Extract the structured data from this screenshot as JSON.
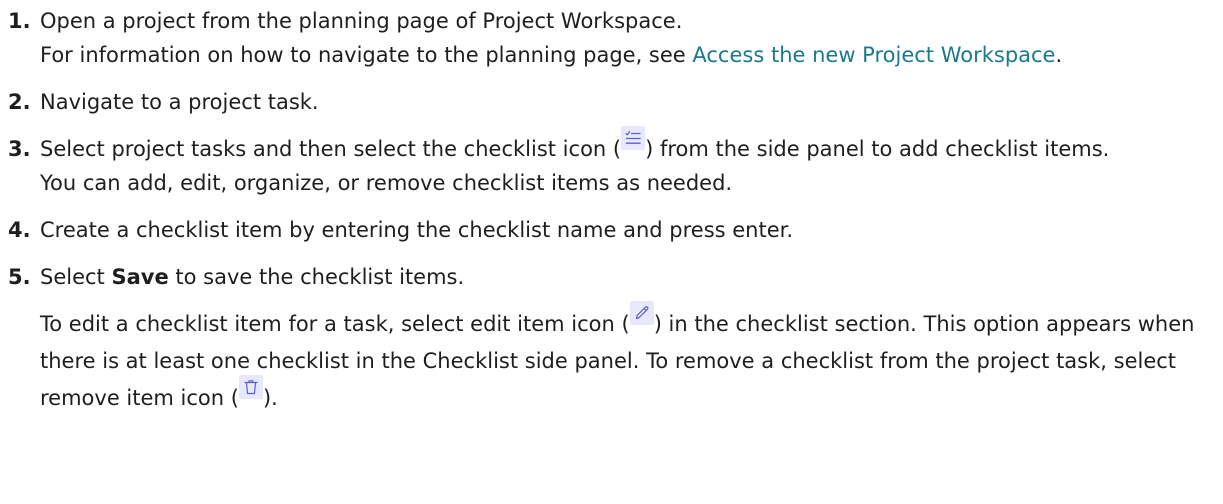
{
  "steps": [
    {
      "number": "1.",
      "line1": "Open a project from the planning page of Project Workspace.",
      "line2_prefix": "For information on how to navigate to the planning page, see ",
      "line2_link": "Access the new Project Workspace",
      "line2_suffix": "."
    },
    {
      "number": "2.",
      "text": "Navigate to a project task."
    },
    {
      "number": "3.",
      "text_before_icon": "Select project tasks and then select the checklist icon (",
      "icon": "checklist-icon",
      "text_after_icon": ") from the side panel to add checklist items.",
      "line2": "You can add, edit, organize, or remove checklist items as needed."
    },
    {
      "number": "4.",
      "text": "Create a checklist item by entering the checklist name and press enter."
    },
    {
      "number": "5.",
      "text_before_bold": "Select ",
      "bold": "Save",
      "text_after_bold": " to save the checklist items.",
      "note_before_edit_icon": "To edit a checklist item for a task, select edit item icon (",
      "edit_icon": "pencil-icon",
      "note_after_edit_icon": ") in the checklist section. This option appears when there is at least one checklist in the Checklist side panel. To remove a checklist from the project task, select remove item icon (",
      "remove_icon": "trash-icon",
      "note_end": ")."
    }
  ],
  "colors": {
    "text": "#1e1e1e",
    "link": "#1a7a8c",
    "icon_background": "#e7e8fb",
    "icon_stroke": "#5c5fc8"
  }
}
